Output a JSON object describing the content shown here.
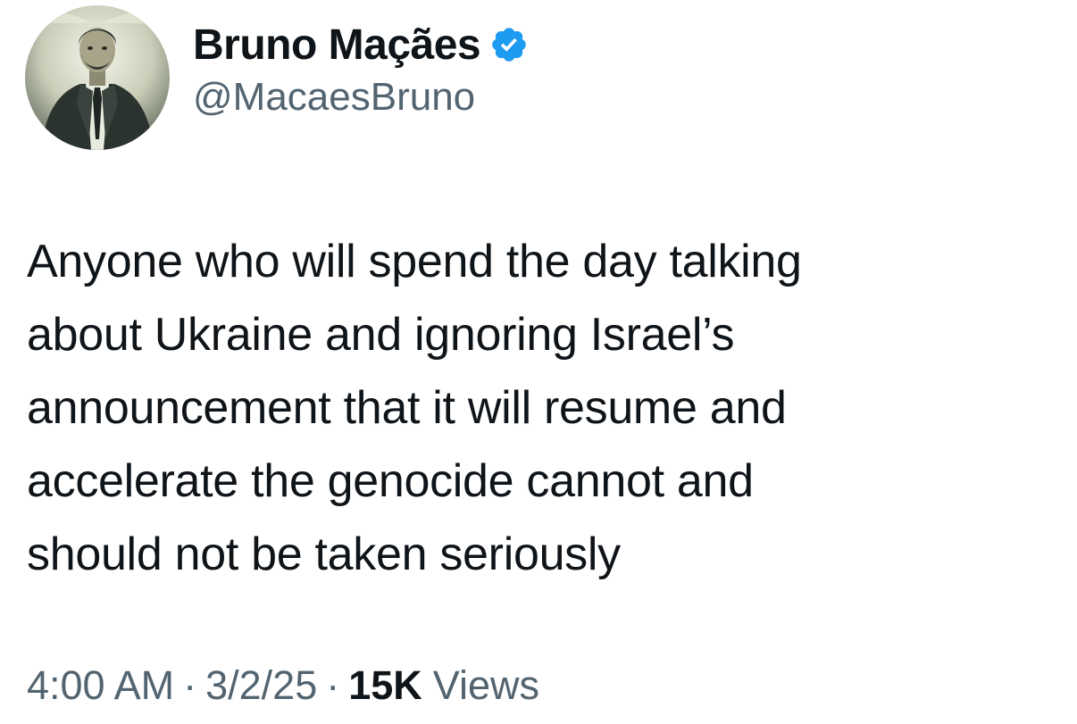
{
  "user": {
    "display_name": "Bruno Maçães",
    "handle": "@MacaesBruno",
    "verified_icon": "verified-badge-icon",
    "verified_color": "#1d9bf0"
  },
  "tweet": {
    "text": "Anyone who will spend the day talking\nabout Ukraine and ignoring Israel’s\nannouncement that it will resume and\naccelerate the genocide cannot and\nshould not be taken seriously"
  },
  "meta": {
    "time": "4:00 AM",
    "separator": "·",
    "date": "3/2/25",
    "views_count": "15K",
    "views_label": "Views"
  },
  "colors": {
    "text_primary": "#0f1419",
    "text_secondary": "#536471",
    "background": "#ffffff"
  }
}
